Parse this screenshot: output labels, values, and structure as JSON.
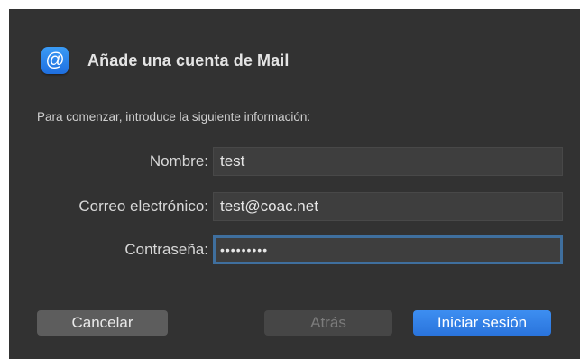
{
  "dialog": {
    "title": "Añade una cuenta de Mail",
    "icon": "at-sign-icon",
    "icon_glyph": "@",
    "accent_color": "#2f80ea",
    "intro": "Para comenzar, introduce la siguiente información:"
  },
  "form": {
    "name_label": "Nombre:",
    "name_value": "test",
    "email_label": "Correo electrónico:",
    "email_value": "test@coac.net",
    "password_label": "Contraseña:",
    "password_value": "•••••••••"
  },
  "buttons": {
    "cancel": "Cancelar",
    "back": "Atrás",
    "sign_in": "Iniciar sesión"
  }
}
